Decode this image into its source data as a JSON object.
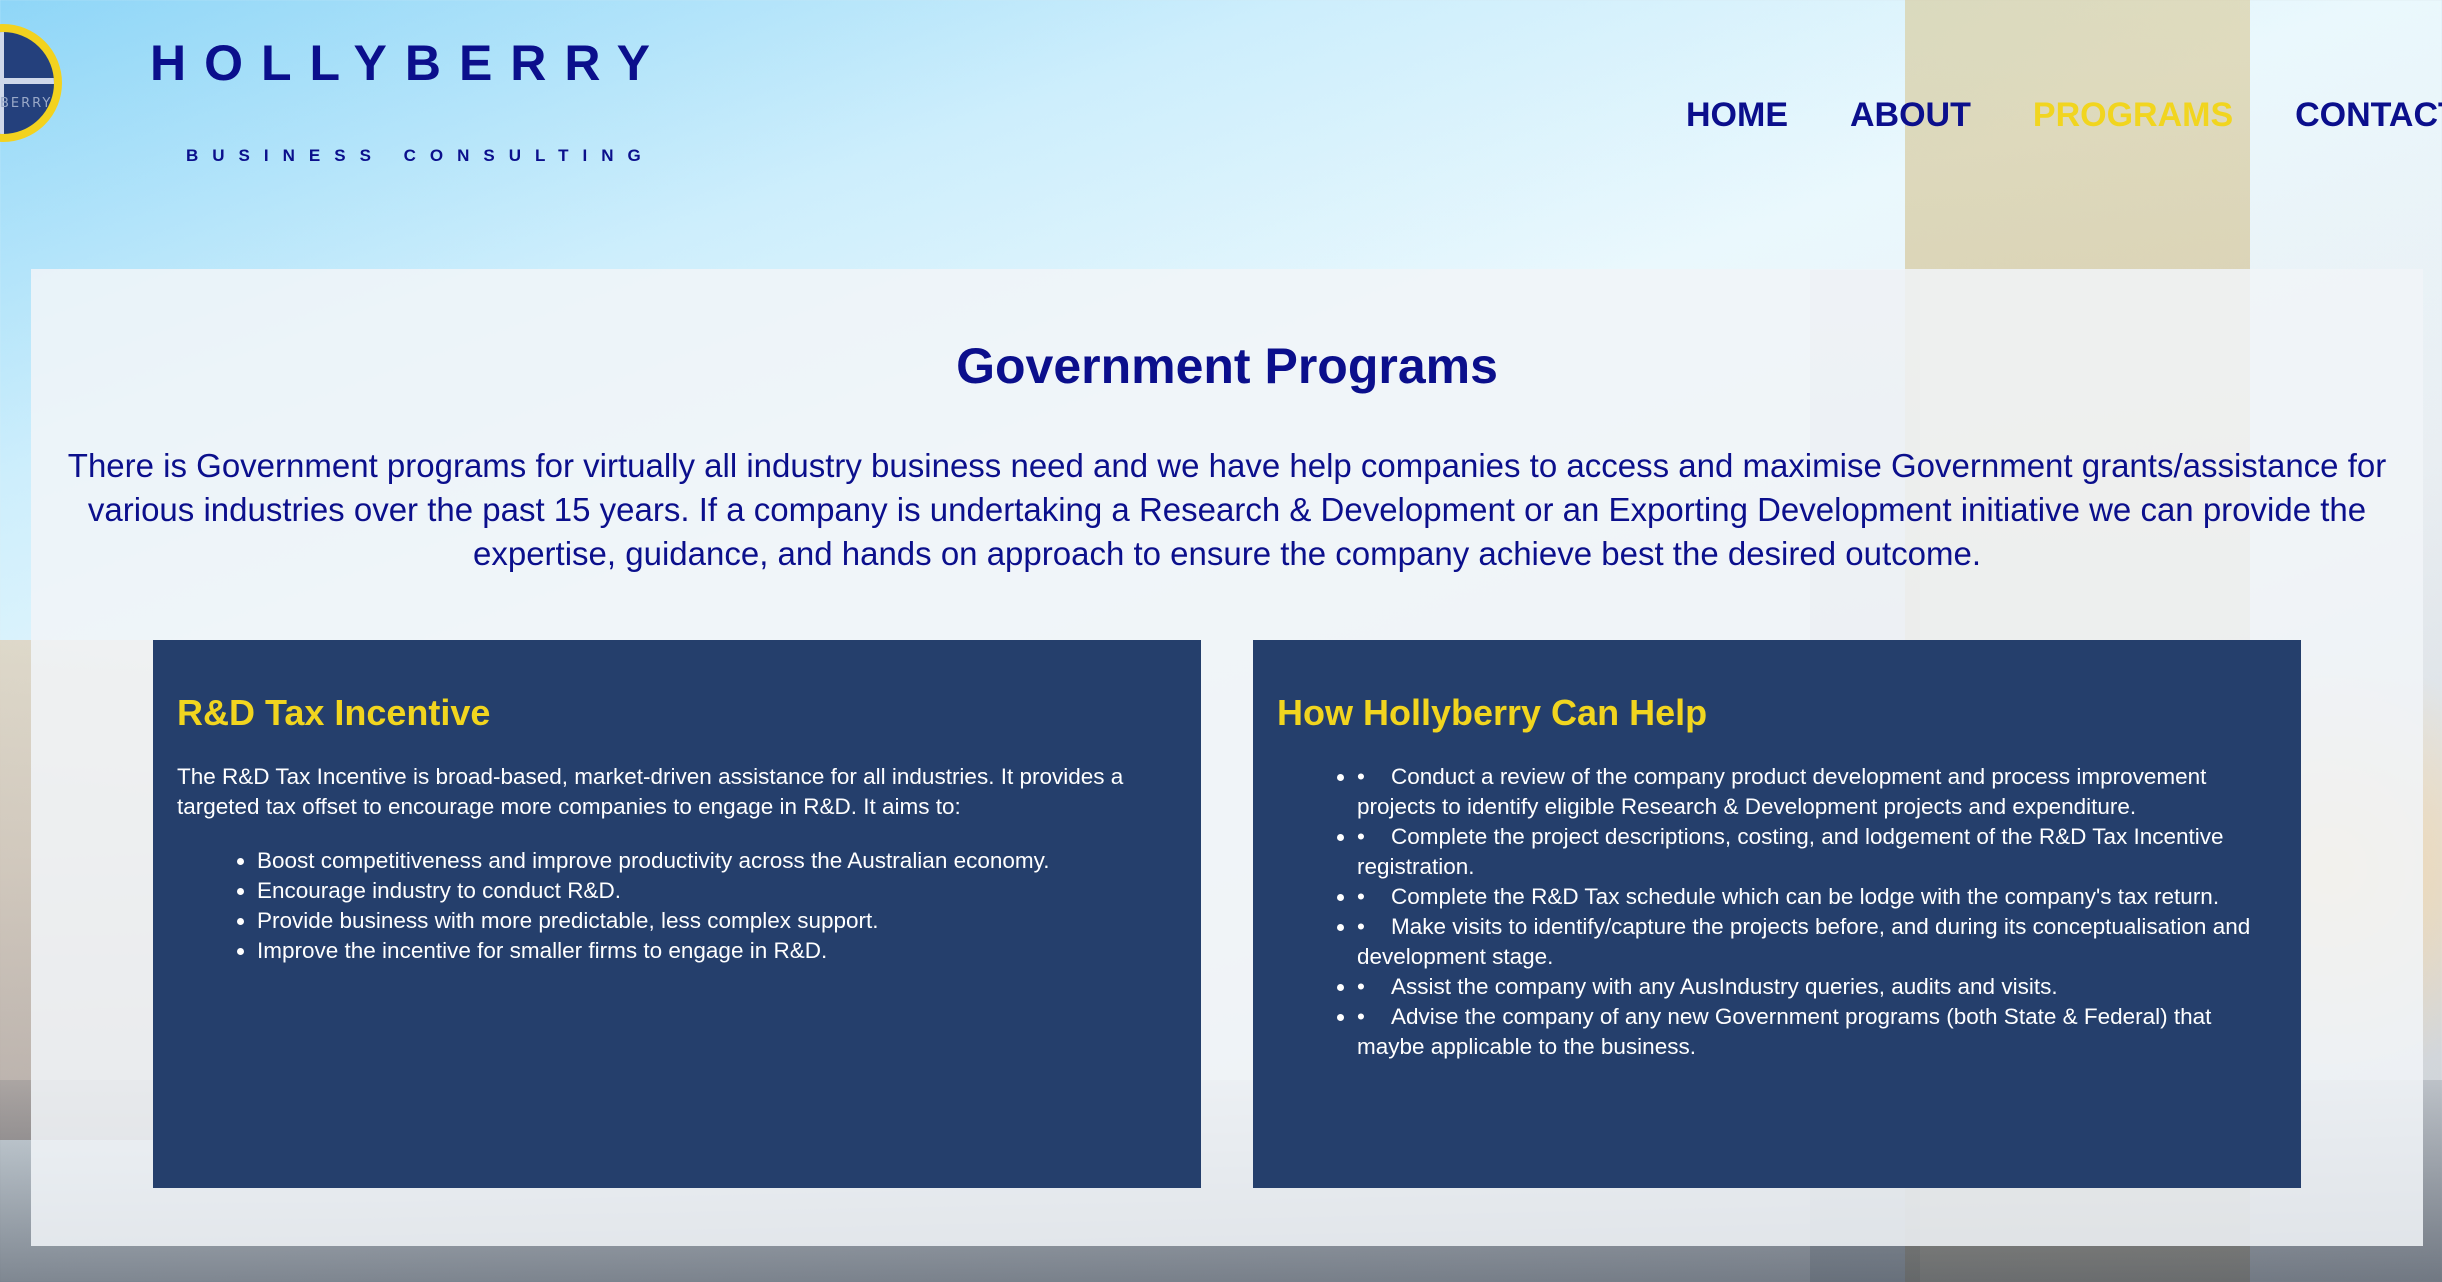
{
  "brand": {
    "name": "HOLLYBERRY",
    "tagline": "BUSINESS CONSULTING",
    "logo_text": "BERRY"
  },
  "nav": {
    "items": [
      {
        "label": "HOME"
      },
      {
        "label": "ABOUT"
      },
      {
        "label": "PROGRAMS"
      },
      {
        "label": "CONTACT"
      }
    ],
    "active": "PROGRAMS"
  },
  "main": {
    "title": "Government Programs",
    "intro": "There is Government programs for virtually all industry business need and we have help companies to access and maximise Government grants/assistance for various industries over the past 15 years. If a company is undertaking a Research & Development or an Exporting Development initiative we can provide the expertise, guidance, and hands on approach to ensure the company achieve best the desired outcome."
  },
  "cards": [
    {
      "title": "R&D Tax Incentive",
      "text": "The R&D Tax Incentive is broad-based, market-driven assistance for all industries. It provides a targeted tax offset to encourage more companies to engage in R&D. It aims to:",
      "items": [
        "Boost competitiveness and improve productivity across the Australian economy.",
        "Encourage industry to conduct R&D.",
        "Provide business with more predictable, less complex support.",
        "Improve the incentive for smaller firms to engage in R&D."
      ]
    },
    {
      "title": "How Hollyberry Can Help",
      "bullet": "•",
      "items": [
        "Conduct a review of the company product development and process improvement projects to identify eligible Research & Development projects and expenditure.",
        "Complete the project descriptions, costing, and lodgement of the R&D Tax Incentive registration.",
        "Complete the R&D Tax schedule which can be lodge with the company's tax return.",
        "Make visits to identify/capture the projects before, and during its conceptualisation and development stage.",
        "Assist the company with any AusIndustry queries, audits and visits.",
        "Advise the company of any new Government programs (both State & Federal) that maybe applicable to the business."
      ]
    }
  ],
  "colors": {
    "brand_navy": "#0b0f8c",
    "accent_yellow": "#f1d51f",
    "card_bg": "#253f6c"
  }
}
